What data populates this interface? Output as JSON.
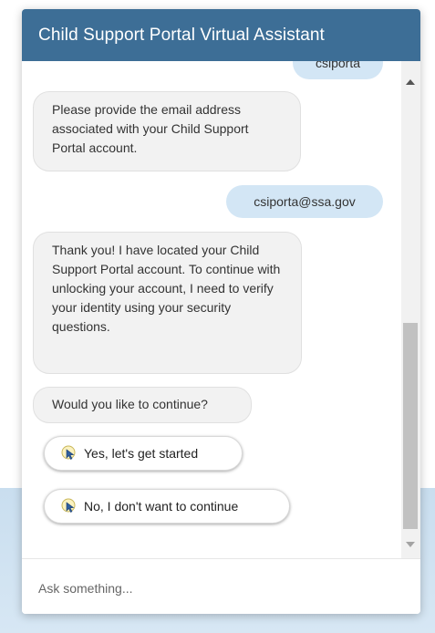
{
  "header": {
    "title": "Child Support Portal Virtual Assistant"
  },
  "messages": [
    {
      "from": "user",
      "text": "csiporta"
    },
    {
      "from": "bot",
      "text": "Please provide the email address associated with your Child Support Portal account."
    },
    {
      "from": "user",
      "text": "csiporta@ssa.gov"
    },
    {
      "from": "bot",
      "text": "Thank you! I have located your Child Support Portal account. To continue with unlocking your account, I need to verify your identity using your security questions."
    },
    {
      "from": "bot",
      "text": "Would you like to continue?"
    }
  ],
  "choices": [
    {
      "label": "Yes, let's get started",
      "icon": "choice-pointer-icon"
    },
    {
      "label": "No, I don't want to continue",
      "icon": "choice-pointer-icon"
    }
  ],
  "input": {
    "placeholder": "Ask something..."
  },
  "colors": {
    "header": "#3d6e96",
    "user_bubble": "#d3e6f5",
    "bot_bubble": "#f2f2f2"
  }
}
